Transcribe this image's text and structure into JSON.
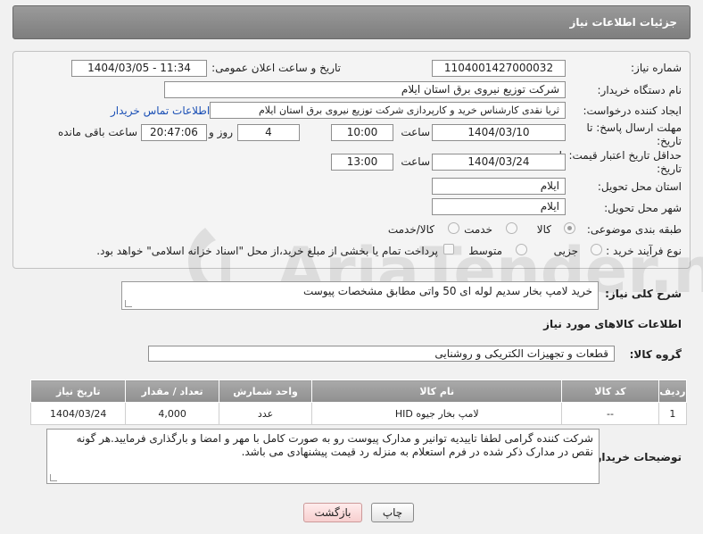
{
  "header": {
    "title": "جزئیات اطلاعات نیاز"
  },
  "form": {
    "need_number_label": "شماره نیاز:",
    "need_number": "1104001427000032",
    "announce_label": "تاریخ و ساعت اعلان عمومی:",
    "announce_value": "1404/03/05 - 11:34",
    "buyer_org_label": "نام دستگاه خریدار:",
    "buyer_org": "شرکت توزیع نیروی برق استان ایلام",
    "creator_label": "ایجاد کننده درخواست:",
    "creator": "ثریا نقدی کارشناس خرید و کارپردازی شرکت توزیع نیروی برق استان ایلام",
    "contact_link": "اطلاعات تماس خریدار",
    "reply_deadline_label": "مهلت ارسال پاسخ: تا تاریخ:",
    "reply_date": "1404/03/10",
    "time_label": "ساعت",
    "reply_time": "10:00",
    "days_value": "4",
    "days_label": "روز و",
    "remaining_value": "20:47:06",
    "remaining_label": "ساعت باقی مانده",
    "price_valid_label": "حداقل تاریخ اعتبار قیمت: تا تاریخ:",
    "price_date": "1404/03/24",
    "price_time": "13:00",
    "province_label": "استان محل تحویل:",
    "province": "ایلام",
    "city_label": "شهر محل تحویل:",
    "city": "ایلام",
    "category_label": "طبقه بندی موضوعی:",
    "category_options": [
      "کالا",
      "خدمت",
      "کالا/خدمت"
    ],
    "process_label": "نوع فرآیند خرید :",
    "process_options": [
      "جزیی",
      "متوسط"
    ],
    "payment_note": "پرداخت تمام یا بخشی از مبلغ خرید،از محل \"اسناد خزانه اسلامی\" خواهد بود."
  },
  "description": {
    "label": "شرح کلی نیاز:",
    "value": "خرید لامپ بخار سدیم لوله ای 50 واتی مطابق مشخصات پیوست"
  },
  "goods": {
    "section_title": "اطلاعات کالاهای مورد نیاز",
    "group_label": "گروه کالا:",
    "group_value": "قطعات و تجهیزات الکتریکی و روشنایی",
    "columns": [
      "ردیف",
      "کد کالا",
      "نام کالا",
      "واحد شمارش",
      "تعداد / مقدار",
      "تاریخ نیاز"
    ],
    "rows": [
      [
        "1",
        "--",
        "لامپ بخار جیوه HID",
        "عدد",
        "4,000",
        "1404/03/24"
      ]
    ]
  },
  "buyer_notes": {
    "label": "توضیحات خریدار:",
    "value": "شرکت کننده گرامی لطفا تاییدیه توانیر و مدارک پیوست رو به صورت کامل با مهر و امضا و بارگذاری فرمایید.هر گونه نقص در مدارک ذکر شده در فرم استعلام به منزله رد قیمت پیشنهادی می باشد."
  },
  "buttons": {
    "print": "چاپ",
    "back": "بازگشت"
  },
  "watermark": {
    "text": "AriaTender.neT"
  }
}
